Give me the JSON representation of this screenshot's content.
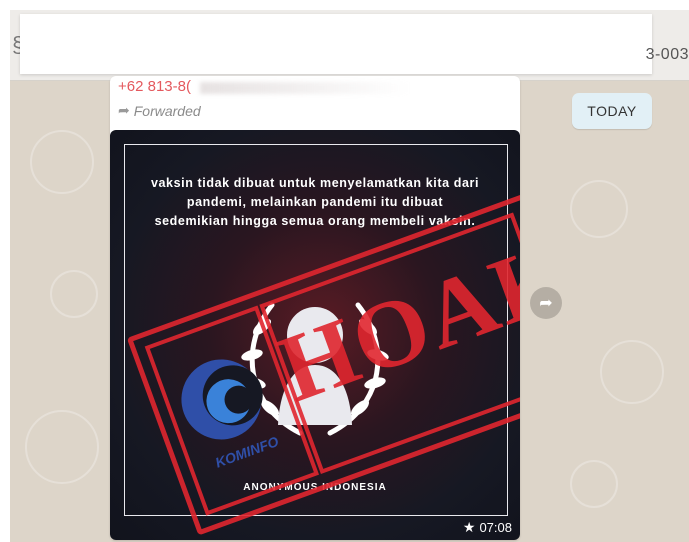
{
  "header": {
    "edge_glyph": "§",
    "edge_number": "3-003"
  },
  "message": {
    "sender": "+62 813-8(",
    "forwarded_label": "Forwarded",
    "forwarded_icon": "forward-arrow-icon",
    "time": "07:08",
    "starred": true,
    "image": {
      "text": "vaksin tidak dibuat untuk menyelamatkan kita dari pandemi, melainkan pandemi itu dibuat sedemikian hingga semua orang membeli vaksin.",
      "org": "ANONYMOUS INDONESIA",
      "stamp_word": "HOAKS",
      "stamp_logo_text": "KOMINFO"
    }
  },
  "date_badge": "TODAY",
  "colors": {
    "chat_background": "#ddd5c9",
    "stamp_red": "#e0262f",
    "sender_color": "#e4595e",
    "date_pill": "#e2f0f6"
  }
}
